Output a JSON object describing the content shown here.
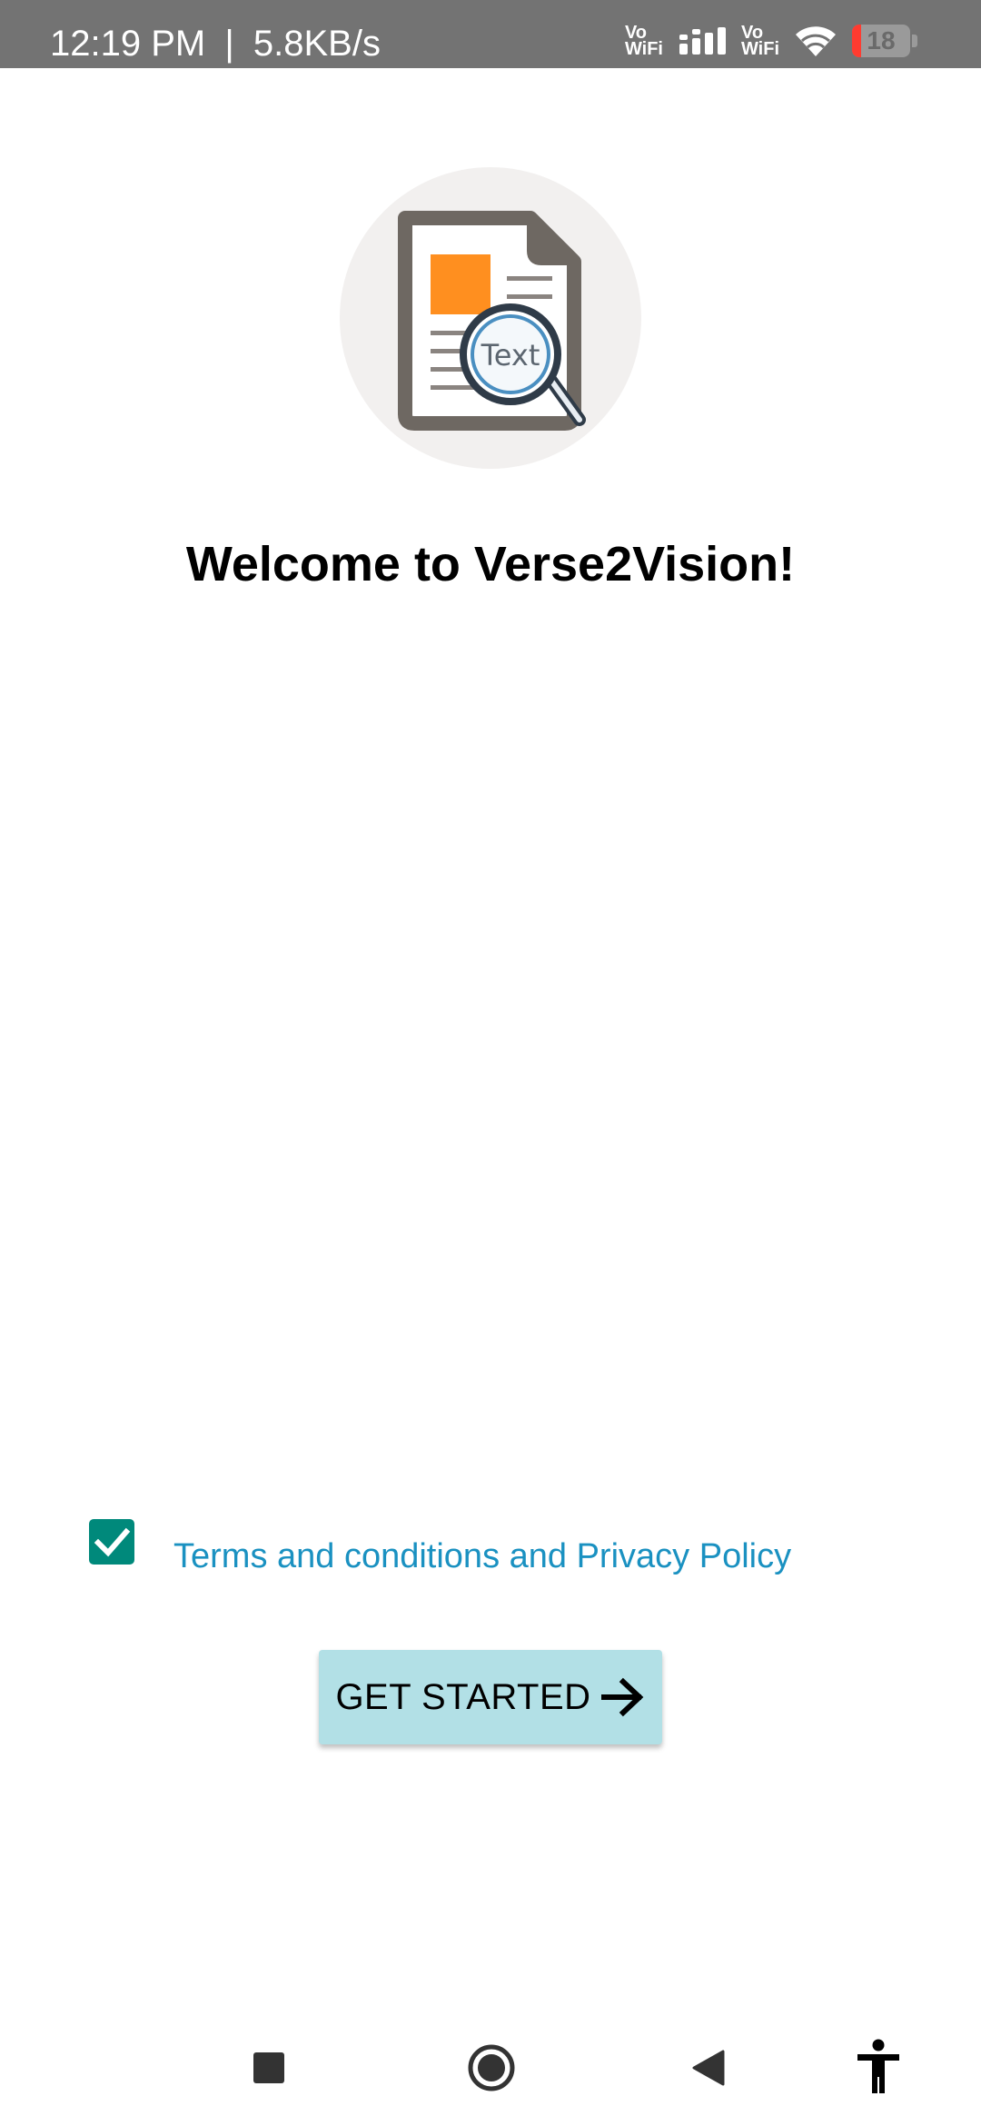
{
  "status_bar": {
    "time": "12:19 PM",
    "separator": "|",
    "network_speed": "5.8KB/s",
    "vowifi_1": "Vo\nWiFi",
    "vowifi_2": "Vo\nWiFi",
    "battery_level": "18",
    "battery_fraction": 0.18,
    "icons": [
      "vowifi-icon",
      "signal-icon",
      "vowifi-icon",
      "wifi-icon",
      "battery-icon"
    ]
  },
  "logo": {
    "label": "Text",
    "icon": "document-search-icon",
    "colors": {
      "doc": "#6e6862",
      "accent": "#ff8f1f",
      "lens": "#4a8fc1"
    }
  },
  "welcome": {
    "title": "Welcome to Verse2Vision!"
  },
  "terms": {
    "checked": true,
    "link_text": "Terms and conditions and Privacy Policy",
    "checkbox_color": "#00897b",
    "link_color": "#1a91c1"
  },
  "cta": {
    "label": "GET STARTED",
    "icon": "arrow-right-icon",
    "background": "#b2e0e6"
  },
  "nav_bar": {
    "items": [
      "recents-square-icon",
      "home-circle-icon",
      "back-triangle-icon",
      "accessibility-icon"
    ]
  }
}
